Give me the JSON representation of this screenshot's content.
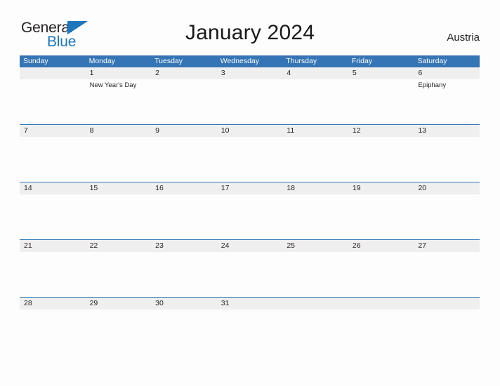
{
  "brand": {
    "word1": "General",
    "word2": "Blue",
    "flag_icon": "triangle-flag-icon",
    "accent_color": "#1c76bc"
  },
  "header": {
    "title": "January 2024",
    "country": "Austria"
  },
  "theme": {
    "header_blue": "#3575b5",
    "rule_blue": "#2f76b8",
    "daynum_band": "#efefef",
    "page_background": "#fdfdfd",
    "text": "#231f20"
  },
  "calendar": {
    "weekdays": [
      "Sunday",
      "Monday",
      "Tuesday",
      "Wednesday",
      "Thursday",
      "Friday",
      "Saturday"
    ],
    "weeks": [
      {
        "days": [
          {
            "num": "",
            "event": ""
          },
          {
            "num": "1",
            "event": "New Year's Day"
          },
          {
            "num": "2",
            "event": ""
          },
          {
            "num": "3",
            "event": ""
          },
          {
            "num": "4",
            "event": ""
          },
          {
            "num": "5",
            "event": ""
          },
          {
            "num": "6",
            "event": "Epiphany"
          }
        ]
      },
      {
        "days": [
          {
            "num": "7",
            "event": ""
          },
          {
            "num": "8",
            "event": ""
          },
          {
            "num": "9",
            "event": ""
          },
          {
            "num": "10",
            "event": ""
          },
          {
            "num": "11",
            "event": ""
          },
          {
            "num": "12",
            "event": ""
          },
          {
            "num": "13",
            "event": ""
          }
        ]
      },
      {
        "days": [
          {
            "num": "14",
            "event": ""
          },
          {
            "num": "15",
            "event": ""
          },
          {
            "num": "16",
            "event": ""
          },
          {
            "num": "17",
            "event": ""
          },
          {
            "num": "18",
            "event": ""
          },
          {
            "num": "19",
            "event": ""
          },
          {
            "num": "20",
            "event": ""
          }
        ]
      },
      {
        "days": [
          {
            "num": "21",
            "event": ""
          },
          {
            "num": "22",
            "event": ""
          },
          {
            "num": "23",
            "event": ""
          },
          {
            "num": "24",
            "event": ""
          },
          {
            "num": "25",
            "event": ""
          },
          {
            "num": "26",
            "event": ""
          },
          {
            "num": "27",
            "event": ""
          }
        ]
      },
      {
        "days": [
          {
            "num": "28",
            "event": ""
          },
          {
            "num": "29",
            "event": ""
          },
          {
            "num": "30",
            "event": ""
          },
          {
            "num": "31",
            "event": ""
          },
          {
            "num": "",
            "event": ""
          },
          {
            "num": "",
            "event": ""
          },
          {
            "num": "",
            "event": ""
          }
        ]
      }
    ]
  }
}
